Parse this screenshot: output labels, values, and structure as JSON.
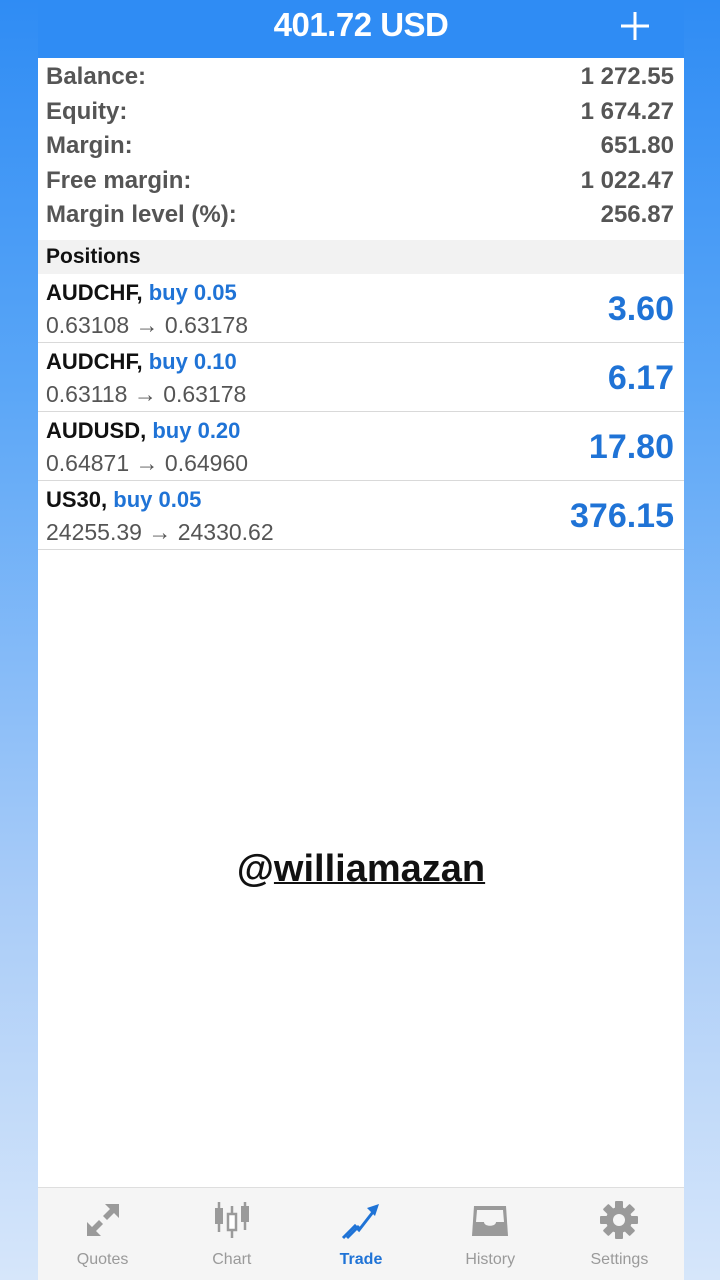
{
  "header": {
    "title": "401.72 USD",
    "add_icon": "plus-icon"
  },
  "summary": [
    {
      "label": "Balance:",
      "value": "1 272.55"
    },
    {
      "label": "Equity:",
      "value": "1 674.27"
    },
    {
      "label": "Margin:",
      "value": "651.80"
    },
    {
      "label": "Free margin:",
      "value": "1 022.47"
    },
    {
      "label": "Margin level (%):",
      "value": "256.87"
    }
  ],
  "positions_header": "Positions",
  "positions": [
    {
      "symbol": "AUDCHF,",
      "side": "buy 0.05",
      "prices": "0.63108 → 0.63178",
      "profit": "3.60"
    },
    {
      "symbol": "AUDCHF,",
      "side": "buy 0.10",
      "prices": "0.63118 → 0.63178",
      "profit": "6.17"
    },
    {
      "symbol": "AUDUSD,",
      "side": "buy 0.20",
      "prices": "0.64871 → 0.64960",
      "profit": "17.80"
    },
    {
      "symbol": "US30,",
      "side": "buy 0.05",
      "prices": "24255.39 → 24330.62",
      "profit": "376.15"
    }
  ],
  "watermark": {
    "at": "@",
    "handle": "williamazan"
  },
  "tabs": [
    {
      "label": "Quotes",
      "icon": "quotes-arrows-icon"
    },
    {
      "label": "Chart",
      "icon": "candlestick-chart-icon"
    },
    {
      "label": "Trade",
      "icon": "trade-trend-icon",
      "active": true
    },
    {
      "label": "History",
      "icon": "inbox-tray-icon"
    },
    {
      "label": "Settings",
      "icon": "gear-icon"
    }
  ],
  "colors": {
    "accent": "#2f8cf4",
    "profit": "#1f73d6",
    "inactive_tab": "#9a9a9a"
  }
}
